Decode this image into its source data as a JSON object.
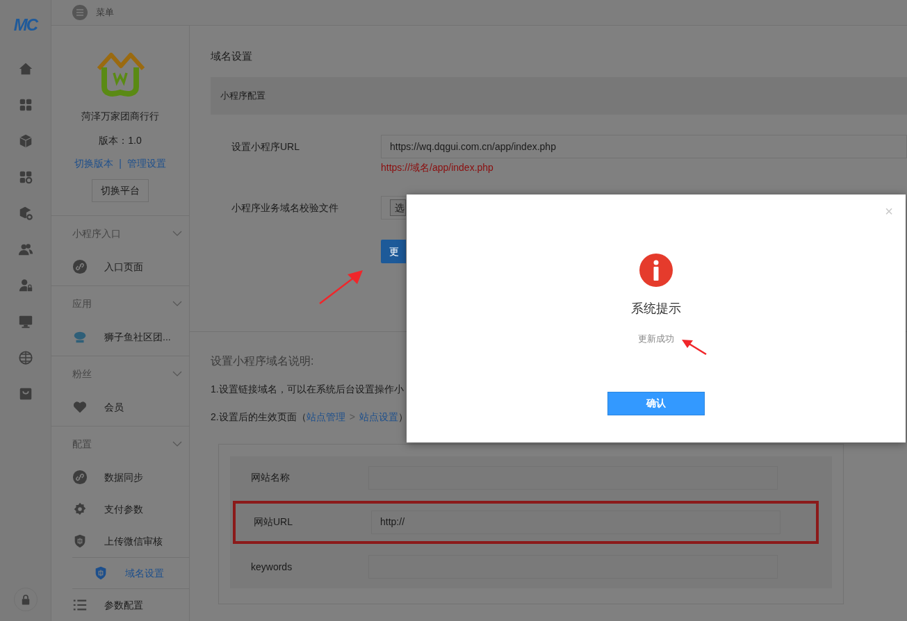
{
  "logo": {
    "text": "MC"
  },
  "header": {
    "menu_label": "菜单"
  },
  "store": {
    "name": "菏泽万家团商行行",
    "version": "版本：1.0",
    "links": [
      "切换版本",
      "管理设置"
    ],
    "separator": "|",
    "switch_button": "切换平台"
  },
  "menu_groups": [
    {
      "title": "小程序入口",
      "items": [
        {
          "label": "入口页面",
          "selected": false
        }
      ]
    },
    {
      "title": "应用",
      "items": [
        {
          "label": "狮子鱼社区团...",
          "selected": false
        }
      ]
    },
    {
      "title": "粉丝",
      "items": [
        {
          "label": "会员",
          "selected": false
        }
      ]
    },
    {
      "title": "配置",
      "items": [
        {
          "label": "数据同步",
          "selected": false
        },
        {
          "label": "支付参数",
          "selected": false
        },
        {
          "label": "上传微信审核",
          "selected": false
        },
        {
          "label": "域名设置",
          "selected": true
        },
        {
          "label": "参数配置",
          "selected": false
        }
      ]
    }
  ],
  "page_title": "域名设置",
  "panel": {
    "title": "小程序配置",
    "url_label": "设置小程序URL",
    "url_value": "https://wq.dqgui.com.cn/app/index.php",
    "url_hint": "https://域名/app/index.php",
    "file_label": "小程序业务域名校验文件",
    "file_button": "选",
    "update_button": "更"
  },
  "notes": {
    "title": "设置小程序域名说明:",
    "line_1": "1.设置链接域名，可以在系统后台设置操作小",
    "line_2_prefix": "2.设置后的生效页面（",
    "link_1": "站点管理",
    "link_sep": ">",
    "link_2": "站点设置",
    "line_2_suffix": "）"
  },
  "site_form": [
    {
      "label": "网站名称",
      "highlighted": false
    },
    {
      "label": "网站URL",
      "value": "http://",
      "highlighted": true
    },
    {
      "label": "keywords",
      "highlighted": false
    }
  ],
  "dialog": {
    "close": "×",
    "title": "系统提示",
    "message": "更新成功",
    "confirm": "确认"
  }
}
